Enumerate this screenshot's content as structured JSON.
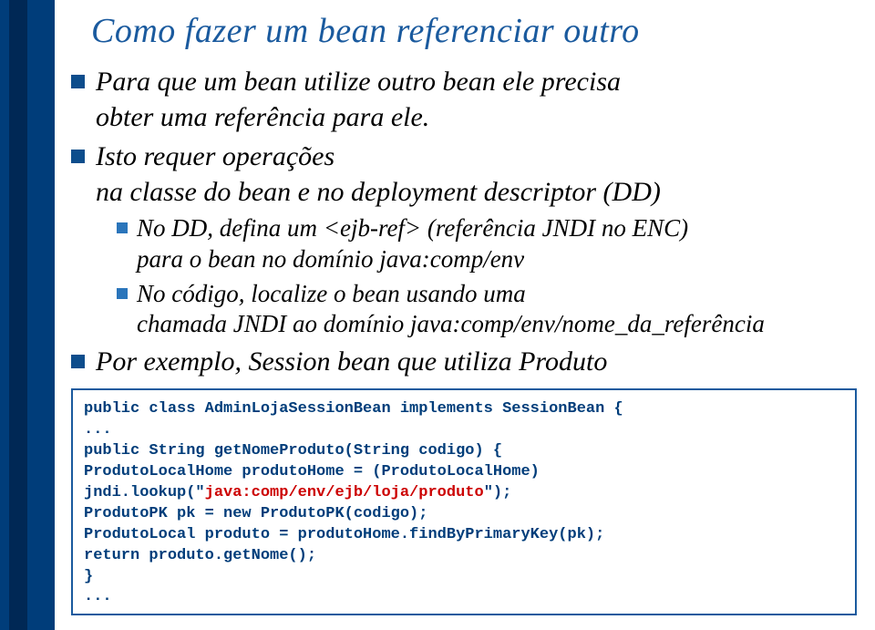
{
  "title": "Como fazer um bean referenciar outro",
  "bullet1_line1": "Para que um bean utilize outro bean ele precisa",
  "bullet1_line2": "obter uma referência para ele.",
  "bullet2_line1": "Isto requer operações",
  "bullet2_line2": "na classe do bean e no deployment descriptor (DD)",
  "sub1_line1": "No DD, defina um <ejb-ref> (referência JNDI no ENC)",
  "sub1_line2": "para o bean no domínio java:comp/env",
  "sub2_line1": "No código, localize o bean usando uma",
  "sub2_line2": "chamada JNDI ao domínio java:comp/env/nome_da_referência",
  "bullet3": "Por exemplo, Session bean que utiliza Produto",
  "code": {
    "l1": "public class AdminLojaSessionBean implements SessionBean {",
    "l2": "  ...",
    "l3": "  public String getNomeProduto(String codigo) {",
    "l4a": "    ProdutoLocalHome produtoHome = (ProdutoLocalHome)",
    "l4b": "        jndi.lookup(\"",
    "l4c": "java:comp/env/ejb/loja/produto",
    "l4d": "\");",
    "l5": "    ProdutoPK pk = new ProdutoPK(codigo);",
    "l6": "    ProdutoLocal produto = produtoHome.findByPrimaryKey(pk);",
    "l7": "    return produto.getNome();",
    "l8": "  }",
    "l9": "  ..."
  }
}
